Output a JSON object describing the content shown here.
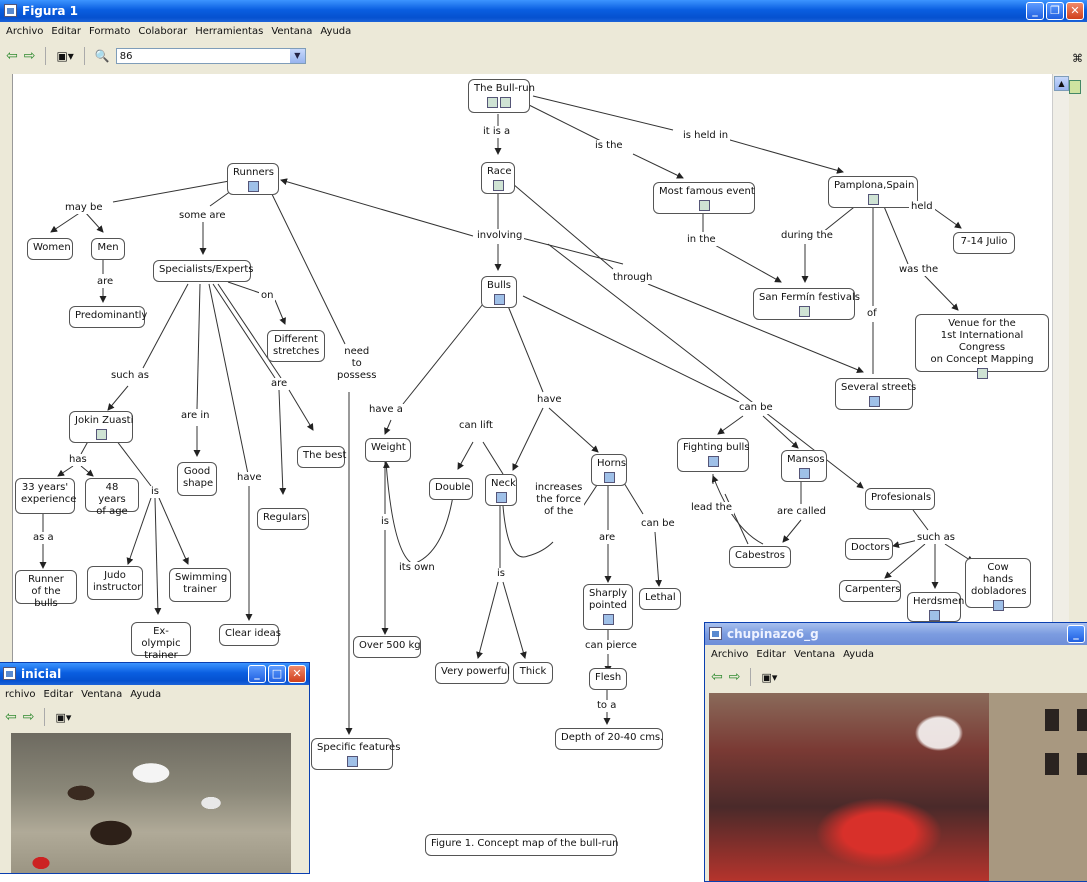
{
  "main_window": {
    "title": "Figura 1",
    "menu": [
      "Archivo",
      "Editar",
      "Formato",
      "Colaborar",
      "Herramientas",
      "Ventana",
      "Ayuda"
    ],
    "zoom_value": "86"
  },
  "concept_map": {
    "nodes": {
      "bullrun": "The Bull-run",
      "runners": "Runners",
      "race": "Race",
      "famous": "Most famous event",
      "pamplona": "Pamplona,Spain",
      "women": "Women",
      "men": "Men",
      "specialists": "Specialists/Experts",
      "predominantly": "Predominantly",
      "different": "Different\nstretches",
      "bulls": "Bulls",
      "sanfermin": "San Fermín festivals",
      "julio": "7-14 Julio",
      "venue": "Venue for the\n1st International Congress\non Concept Mapping",
      "several": "Several streets",
      "jokin": "Jokin Zuasti",
      "good": "Good\nshape",
      "thebest": "The best",
      "regulars": "Regulars",
      "weight": "Weight",
      "double": "Double",
      "neck": "Neck",
      "horns": "Horns",
      "fighting": "Fighting bulls",
      "mansos": "Mansos",
      "profesionals": "Profesionals",
      "exp33": "33 years'\nexperience",
      "age48": "48 years\nof age",
      "runnerbulls": "Runner\nof the bulls",
      "judo": "Judo\ninstructor",
      "swimming": "Swimming\ntrainer",
      "exolympic": "Ex-olympic\ntrainer",
      "clear": "Clear ideas",
      "over500": "Over 500 kg",
      "verypowerful": "Very powerful",
      "thick": "Thick",
      "sharply": "Sharply\npointed",
      "lethal": "Lethal",
      "flesh": "Flesh",
      "depth": "Depth of 20-40 cms.",
      "cabestros": "Cabestros",
      "doctors": "Doctors",
      "carpenters": "Carpenters",
      "herdsmen": "Herdsmen",
      "cowhands": "Cow hands\ndobladores",
      "specific": "Specific features",
      "caption": "Figure 1. Concept map of the bull-run"
    },
    "links": {
      "itisa": "it is a",
      "isthe": "is the",
      "isheldin": "is held in",
      "maybe": "may be",
      "someare": "some are",
      "are_men": "are",
      "on": "on",
      "involving": "involving",
      "through": "through",
      "inthe": "in the",
      "duringthe": "during the",
      "held": "held",
      "wasthe": "was the",
      "of": "of",
      "suchas1": "such as",
      "arein": "are in",
      "are2": "are",
      "have1": "have",
      "need": "need\nto\npossess",
      "has": "has",
      "is_j": "is",
      "asa": "as a",
      "havea": "have a",
      "canlift": "can lift",
      "have2": "have",
      "canbe1": "can be",
      "is_w": "is",
      "itsown": "its own",
      "is_n": "is",
      "increases": "increases\nthe force\nof the",
      "are_h": "are",
      "canbe2": "can be",
      "canpierce": "can pierce",
      "toa": "to a",
      "leadthe": "lead the",
      "arecalled": "are called",
      "suchas2": "such as"
    }
  },
  "window_inicial": {
    "title": "inicial",
    "menu": [
      "rchivo",
      "Editar",
      "Ventana",
      "Ayuda"
    ]
  },
  "window_chupinazo": {
    "title": "chupinazo6_g",
    "menu": [
      "Archivo",
      "Editar",
      "Ventana",
      "Ayuda"
    ]
  }
}
